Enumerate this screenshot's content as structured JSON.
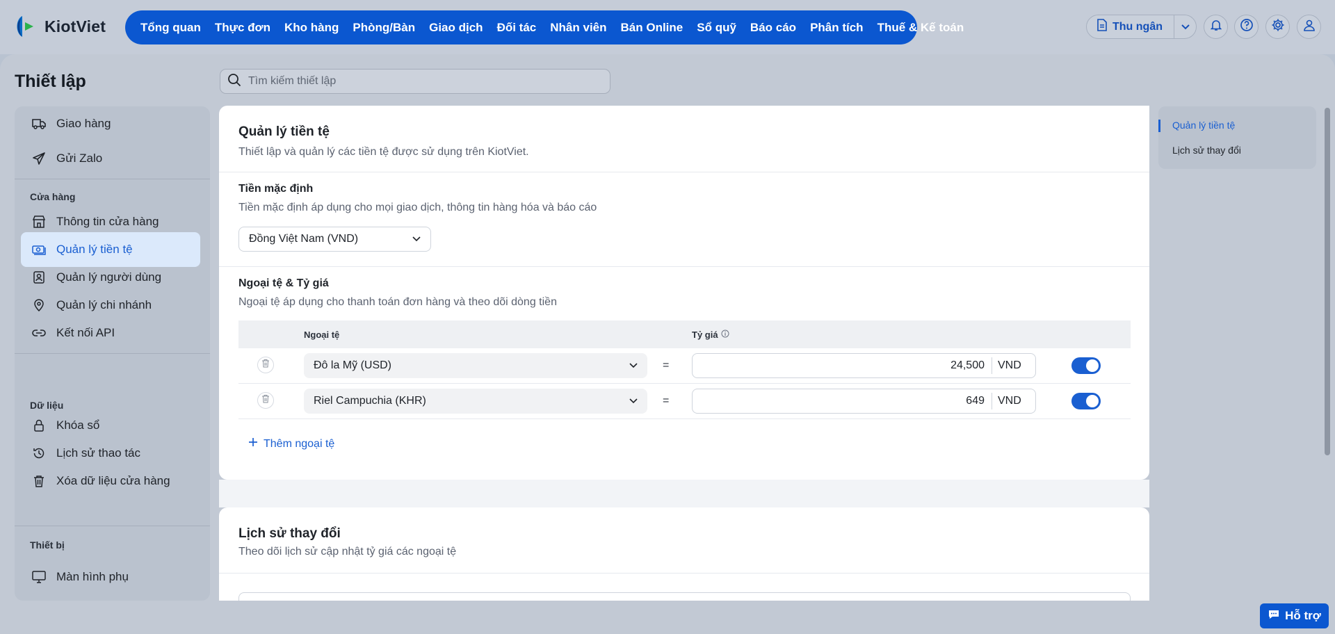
{
  "app": {
    "logo_text": "KiotViet"
  },
  "main_nav": [
    "Tổng quan",
    "Thực đơn",
    "Kho hàng",
    "Phòng/Bàn",
    "Giao dịch",
    "Đối tác",
    "Nhân viên",
    "Bán Online",
    "Sổ quỹ",
    "Báo cáo",
    "Phân tích",
    "Thuế & Kế toán"
  ],
  "header_actions": {
    "cashier_label": "Thu ngân"
  },
  "page": {
    "title": "Thiết lập",
    "search_placeholder": "Tìm kiếm thiết lập"
  },
  "sidebar": {
    "top_items": [
      "Giao hàng",
      "Gửi Zalo"
    ],
    "groups": [
      {
        "label": "Cửa hàng",
        "items": [
          "Thông tin cửa hàng",
          "Quản lý tiền tệ",
          "Quản lý người dùng",
          "Quản lý chi nhánh",
          "Kết nối API"
        ]
      },
      {
        "label": "Dữ liệu",
        "items": [
          "Khóa sổ",
          "Lịch sử thao tác",
          "Xóa dữ liệu cửa hàng"
        ]
      },
      {
        "label": "Thiết bị",
        "items": [
          "Màn hình phụ"
        ]
      }
    ],
    "active_item": "Quản lý tiền tệ"
  },
  "currency": {
    "title": "Quản lý tiền tệ",
    "subtitle": "Thiết lập và quản lý các tiền tệ được sử dụng trên KiotViet.",
    "default_title": "Tiền mặc định",
    "default_desc": "Tiền mặc định áp dụng cho mọi giao dịch, thông tin hàng hóa và báo cáo",
    "default_value": "Đồng Việt Nam (VND)",
    "fx_title": "Ngoại tệ & Tỷ giá",
    "fx_desc": "Ngoại tệ áp dụng cho thanh toán đơn hàng và theo dõi dòng tiền",
    "table_headers": {
      "currency": "Ngoại tệ",
      "rate": "Tỷ giá"
    },
    "rows": [
      {
        "currency": "Đô la Mỹ (USD)",
        "rate": "24,500",
        "unit": "VND",
        "enabled": true
      },
      {
        "currency": "Riel Campuchia (KHR)",
        "rate": "649",
        "unit": "VND",
        "enabled": true
      }
    ],
    "equals": "=",
    "add_label": "Thêm ngoại tệ"
  },
  "history": {
    "title": "Lịch sử thay đổi",
    "subtitle": "Theo dõi lịch sử cập nhật tỷ giá các ngoại tệ"
  },
  "anchor_nav": [
    "Quản lý tiền tệ",
    "Lịch sử thay đổi"
  ],
  "help_button": "Hỗ trợ",
  "colors": {
    "brand_blue": "#0b57d0",
    "link_blue": "#1a5fd1",
    "active_bg": "#dbe9fb"
  }
}
